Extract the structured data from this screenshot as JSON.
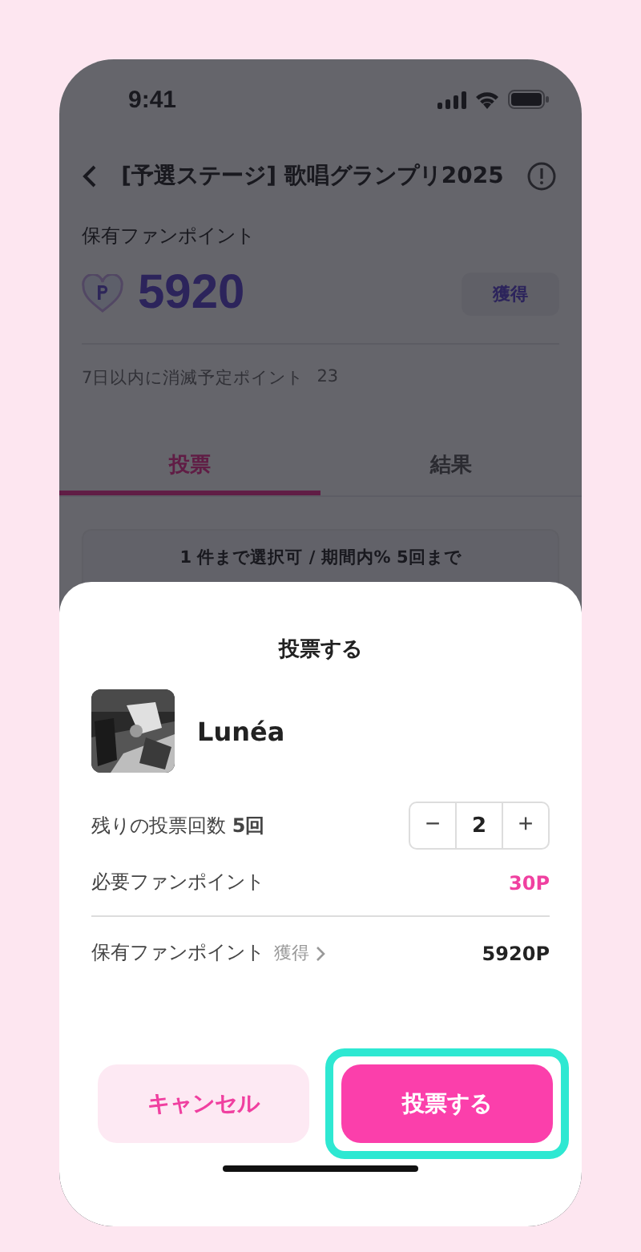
{
  "status_bar": {
    "time": "9:41"
  },
  "nav": {
    "title": "[予選ステージ] 歌唱グランプリ2025"
  },
  "points": {
    "label": "保有ファンポイント",
    "value": "5920",
    "earn_button": "獲得",
    "expiring_label": "7日以内に消滅予定ポイント",
    "expiring_value": "23"
  },
  "tabs": [
    {
      "label": "投票",
      "selected": true
    },
    {
      "label": "結果",
      "selected": false
    }
  ],
  "notice": "1 件まで選択可 / 期間内% 5回まで",
  "sheet": {
    "title": "投票する",
    "candidate": {
      "name": "Lunéa"
    },
    "remaining": "残りの投票回数 **5回**",
    "stepper": {
      "minus": "−",
      "value": "2",
      "plus": "+"
    },
    "required_label": "必要ファンポイント",
    "required_value": "30P",
    "owned_label": "保有ファンポイント",
    "owned_link": "獲得",
    "owned_value": "5920P",
    "buttons": [
      {
        "label": "キャンセル",
        "kind": "secondary",
        "highlighted": false
      },
      {
        "label": "投票する",
        "kind": "primary",
        "highlighted": true
      }
    ]
  }
}
